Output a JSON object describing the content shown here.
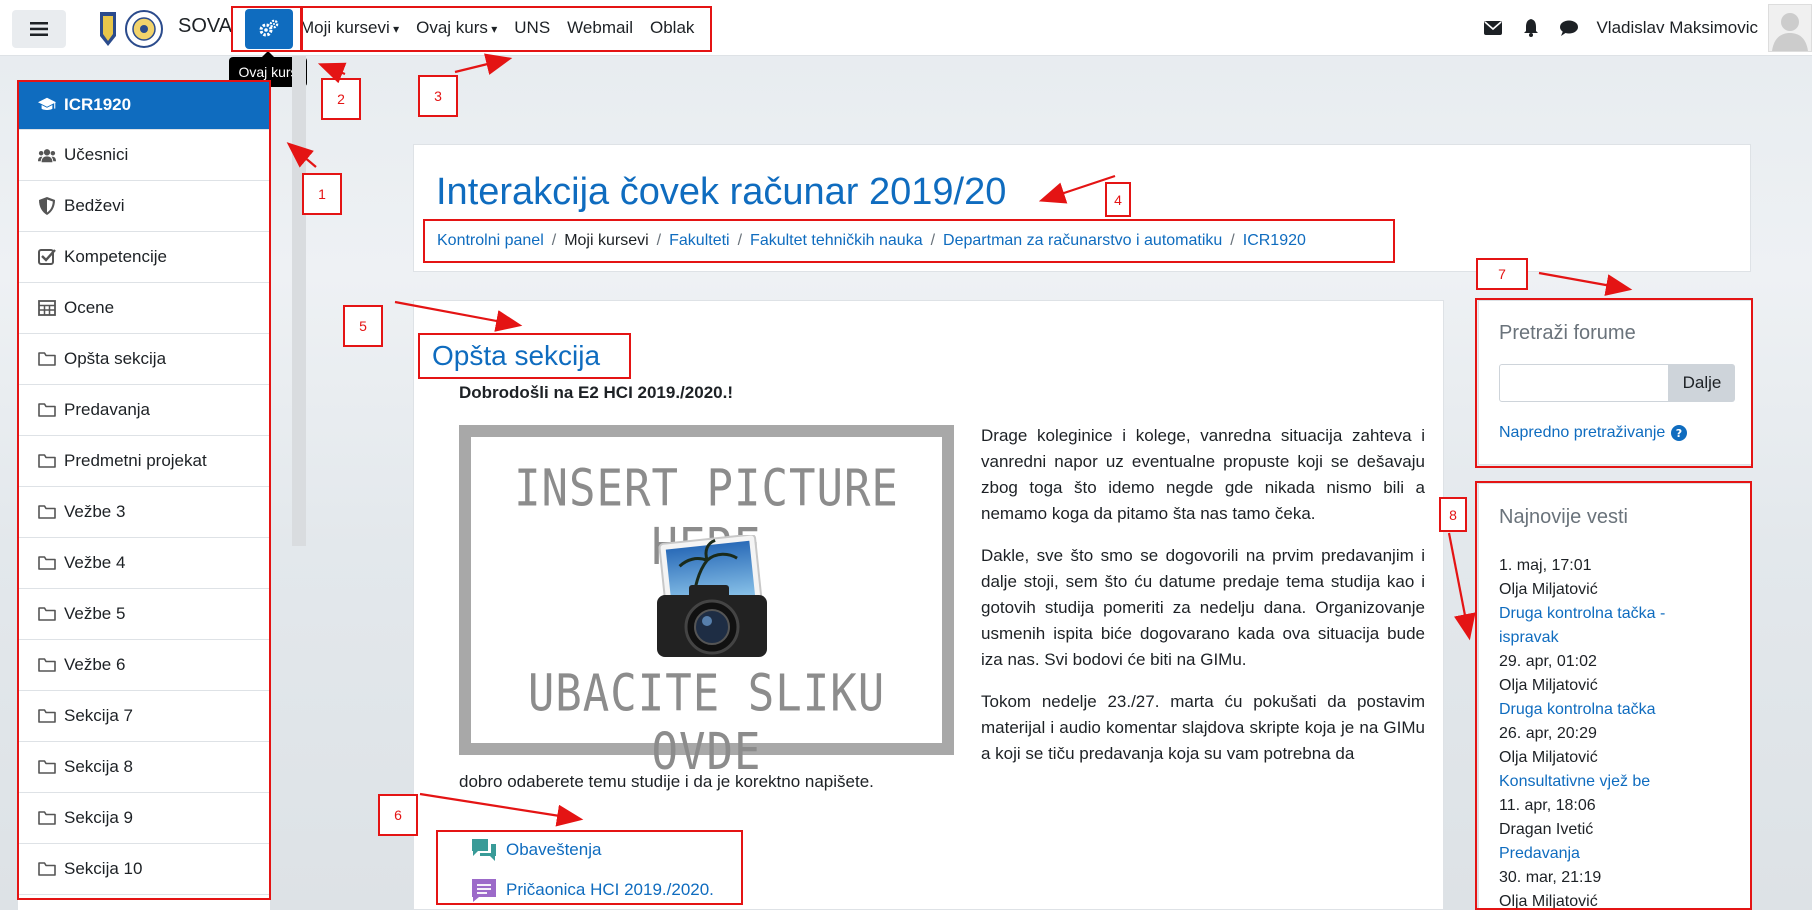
{
  "navbar": {
    "brand": "SOVA",
    "tooltip": "Ovaj kurs",
    "menu": [
      "Moji kursevi",
      "Ovaj kurs",
      "UNS",
      "Webmail",
      "Oblak"
    ],
    "username": "Vladislav Maksimovic",
    "icons": [
      "envelope-icon",
      "bell-icon",
      "chat-bubble-icon"
    ]
  },
  "sidebar": {
    "items": [
      {
        "label": "ICR1920",
        "icon": "graduation-cap-icon",
        "active": true
      },
      {
        "label": "Učesnici",
        "icon": "users-icon"
      },
      {
        "label": "Bedževi",
        "icon": "shield-icon"
      },
      {
        "label": "Kompetencije",
        "icon": "checkbox-icon"
      },
      {
        "label": "Ocene",
        "icon": "table-icon"
      },
      {
        "label": "Opšta sekcija",
        "icon": "folder-icon"
      },
      {
        "label": "Predavanja",
        "icon": "folder-icon"
      },
      {
        "label": "Predmetni projekat",
        "icon": "folder-icon"
      },
      {
        "label": "Vežbe 3",
        "icon": "folder-icon"
      },
      {
        "label": "Vežbe 4",
        "icon": "folder-icon"
      },
      {
        "label": "Vežbe 5",
        "icon": "folder-icon"
      },
      {
        "label": "Vežbe 6",
        "icon": "folder-icon"
      },
      {
        "label": "Sekcija 7",
        "icon": "folder-icon"
      },
      {
        "label": "Sekcija 8",
        "icon": "folder-icon"
      },
      {
        "label": "Sekcija 9",
        "icon": "folder-icon"
      },
      {
        "label": "Sekcija 10",
        "icon": "folder-icon"
      }
    ]
  },
  "header": {
    "title": "Interakcija čovek računar 2019/20",
    "breadcrumb": [
      {
        "label": "Kontrolni panel",
        "link": true
      },
      {
        "label": "Moji kursevi",
        "link": false
      },
      {
        "label": "Fakulteti",
        "link": true
      },
      {
        "label": "Fakultet tehničkih nauka",
        "link": true
      },
      {
        "label": "Departman za računarstvo i automatiku",
        "link": true
      },
      {
        "label": "ICR1920",
        "link": true
      }
    ]
  },
  "section": {
    "title": "Opšta sekcija",
    "welcome": "Dobrodošli na E2 HCI 2019./2020.!",
    "picture_top": "INSERT PICTURE HERE",
    "picture_bottom": "UBACITE SLIKU OVDE",
    "paragraphs": [
      "Drage koleginice i kolege, vanredna situacija zahteva i vanredni napor uz eventualne propuste koji se dešavaju zbog toga što idemo negde gde nikada nismo bili a nemamo koga da pitamo šta nas tamo čeka.",
      "Dakle, sve što smo se dogovorili na prvim predavanjim i dalje stoji, sem što ću datume predaje tema studija kao i gotovih studija pomeriti za nedelju dana. Organizovanje usmenih ispita biće dogovarano kada ova situacija bude iza nas. Svi bodovi će biti na GIMu.",
      "Tokom nedelje 23./27. marta ću pokušati da postavim materijal i audio komentar slajdova skripte koja je na GIMu a koji se tiču predavanja koja su vam potrebna da"
    ],
    "tail": "dobro odaberete temu studije i da je korektno napišete.",
    "activities": [
      {
        "label": "Obaveštenja",
        "icon": "forum-icon",
        "color": "#399b98"
      },
      {
        "label": "Pričaonica HCI 2019./2020.",
        "icon": "chat-icon",
        "color": "#9c6ac9"
      }
    ]
  },
  "search_block": {
    "title": "Pretraži forume",
    "button": "Dalje",
    "input_value": "",
    "advanced": "Napredno pretraživanje"
  },
  "news_block": {
    "title": "Najnovije vesti",
    "items": [
      {
        "date": "1. maj, 17:01",
        "author": "Olja Miljatović",
        "title": "Druga kontrolna tačka - ispravak"
      },
      {
        "date": "29. apr, 01:02",
        "author": "Olja Miljatović",
        "title": "Druga kontrolna tačka"
      },
      {
        "date": "26. apr, 20:29",
        "author": "Olja Miljatović",
        "title": "Konsultativne vjež be"
      },
      {
        "date": "11. apr, 18:06",
        "author": "Dragan Ivetić",
        "title": "Predavanja"
      },
      {
        "date": "30. mar, 21:19",
        "author": "Olja Miljatović",
        "title": ""
      }
    ]
  },
  "annotations": [
    "1",
    "2",
    "3",
    "4",
    "5",
    "6",
    "7",
    "8"
  ],
  "colors": {
    "accent": "#0f6cbf",
    "annotation": "#e41414"
  }
}
